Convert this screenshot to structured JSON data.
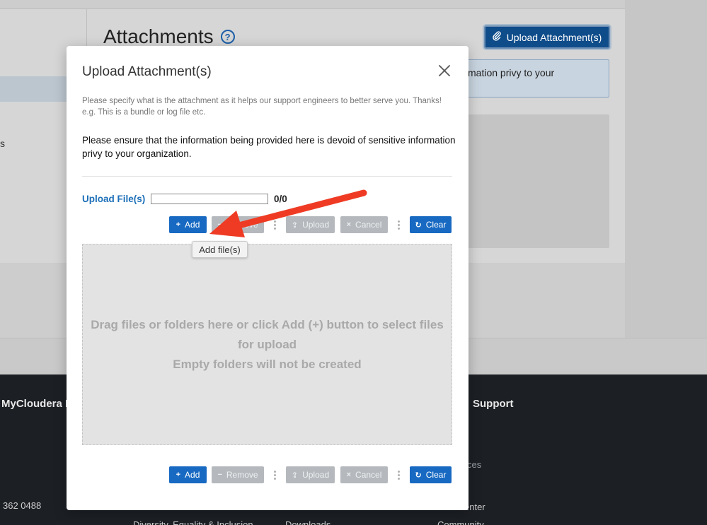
{
  "background": {
    "page_title": "Attachments",
    "help_icon_glyph": "?",
    "upload_button_label": "Upload Attachment(s)",
    "info_text": "mation privy to your",
    "left_fragment": "s"
  },
  "footer": {
    "col1_heading": "MyCloudera H",
    "col2_heading": "Support",
    "services_fragment": "ces",
    "phone_fragment": "362 0488",
    "center_fragment": "enter",
    "diversity_link": "Diversity, Equality & Inclusion",
    "downloads_link": "Downloads",
    "community_link": "Community"
  },
  "modal": {
    "title": "Upload Attachment(s)",
    "hint": "Please specify what is the attachment as it helps our support engineers to better serve you. Thanks! e.g. This is a bundle or log file etc.",
    "notice": "Please ensure that the information being provided here is devoid of sensitive information privy to your organization.",
    "upload_label": "Upload File(s)",
    "progress_fraction": 0,
    "progress_count": "0/0",
    "toolbar": {
      "add_label": "Add",
      "remove_label": "Remove",
      "upload_label": "Upload",
      "cancel_label": "Cancel",
      "clear_label": "Clear",
      "add_glyph": "+",
      "remove_glyph": "−",
      "upload_glyph": "⇪",
      "cancel_glyph": "×",
      "clear_glyph": "↻"
    },
    "dropzone": {
      "line1": "Drag files or folders here or click Add (+) button to select files for upload",
      "line2": "Empty folders will not be created"
    },
    "tooltip": "Add file(s)"
  },
  "colors": {
    "primary": "#1769c2",
    "disabled": "#b5b9bd",
    "annotation_arrow": "#ef3b24",
    "footer_bg": "#1c1f24"
  },
  "icons": {
    "close": "close-icon",
    "paperclip": "paperclip-icon",
    "help": "help-icon",
    "drag_handle": "drag-handle-icon"
  }
}
